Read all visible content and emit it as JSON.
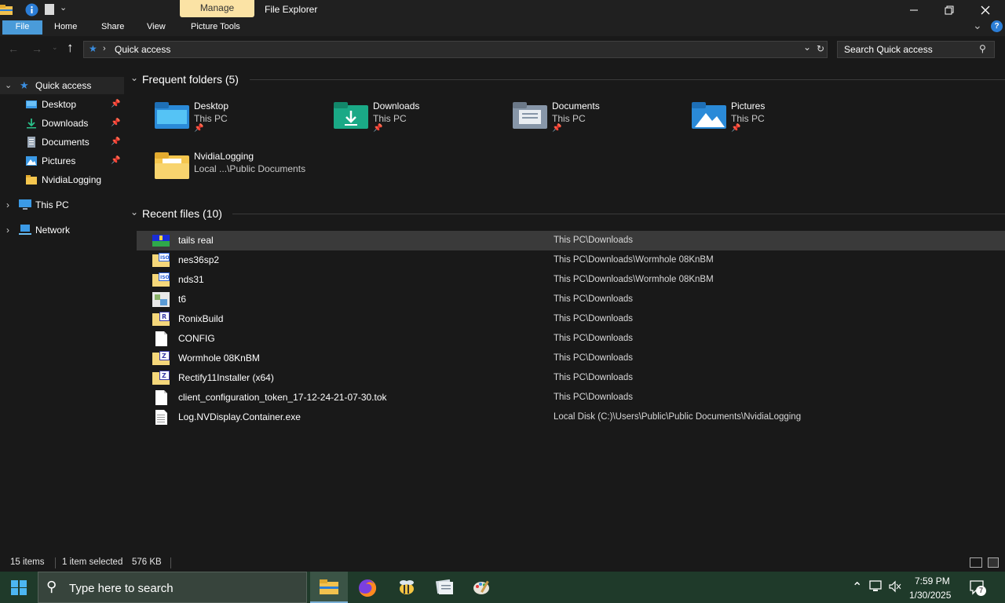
{
  "window": {
    "title": "File Explorer",
    "contextual_tab": "Manage",
    "controls": {
      "minimize": "minimize-icon",
      "maximize": "restore-icon",
      "close": "close-icon"
    }
  },
  "ribbon": {
    "tabs": [
      {
        "label": "File",
        "active": true
      },
      {
        "label": "Home"
      },
      {
        "label": "Share"
      },
      {
        "label": "View"
      },
      {
        "label": "Picture Tools"
      }
    ]
  },
  "address": {
    "path": [
      "Quick access"
    ],
    "search_placeholder": "Search Quick access"
  },
  "nav": {
    "quick_access": "Quick access",
    "items": [
      {
        "label": "Desktop",
        "pinned": true
      },
      {
        "label": "Downloads",
        "pinned": true
      },
      {
        "label": "Documents",
        "pinned": true
      },
      {
        "label": "Pictures",
        "pinned": true
      },
      {
        "label": "NvidiaLogging",
        "pinned": false
      }
    ],
    "this_pc": "This PC",
    "network": "Network"
  },
  "frequent": {
    "heading": "Frequent folders (5)",
    "folders": [
      {
        "name": "Desktop",
        "sub": "This PC",
        "icon": "desktop-folder-icon"
      },
      {
        "name": "Downloads",
        "sub": "This PC",
        "icon": "downloads-folder-icon"
      },
      {
        "name": "Documents",
        "sub": "This PC",
        "icon": "documents-folder-icon"
      },
      {
        "name": "Pictures",
        "sub": "This PC",
        "icon": "pictures-folder-icon"
      },
      {
        "name": "NvidiaLogging",
        "sub": "Local ...\\Public Documents",
        "icon": "folder-icon"
      }
    ]
  },
  "recent": {
    "heading": "Recent files (10)",
    "files": [
      {
        "name": "tails real",
        "path": "This PC\\Downloads",
        "icon": "image-file-icon",
        "selected": true
      },
      {
        "name": "nes36sp2",
        "path": "This PC\\Downloads\\Wormhole 08KnBM",
        "icon": "iso-file-icon"
      },
      {
        "name": "nds31",
        "path": "This PC\\Downloads\\Wormhole 08KnBM",
        "icon": "iso-file-icon"
      },
      {
        "name": "t6",
        "path": "This PC\\Downloads",
        "icon": "app-file-icon"
      },
      {
        "name": "RonixBuild",
        "path": "This PC\\Downloads",
        "icon": "archive-r-icon"
      },
      {
        "name": "CONFIG",
        "path": "This PC\\Downloads",
        "icon": "blank-file-icon"
      },
      {
        "name": "Wormhole 08KnBM",
        "path": "This PC\\Downloads",
        "icon": "archive-z-icon"
      },
      {
        "name": "Rectify11Installer (x64)",
        "path": "This PC\\Downloads",
        "icon": "archive-z-icon"
      },
      {
        "name": "client_configuration_token_17-12-24-21-07-30.tok",
        "path": "This PC\\Downloads",
        "icon": "blank-file-icon"
      },
      {
        "name": "Log.NVDisplay.Container.exe",
        "path": "Local Disk (C:)\\Users\\Public\\Public Documents\\NvidiaLogging",
        "icon": "text-file-icon"
      }
    ]
  },
  "status": {
    "items": "15 items",
    "selected": "1 item selected",
    "size": "576 KB"
  },
  "taskbar": {
    "search_placeholder": "Type here to search",
    "time": "7:59 PM",
    "date": "1/30/2025",
    "notifications": "7"
  }
}
